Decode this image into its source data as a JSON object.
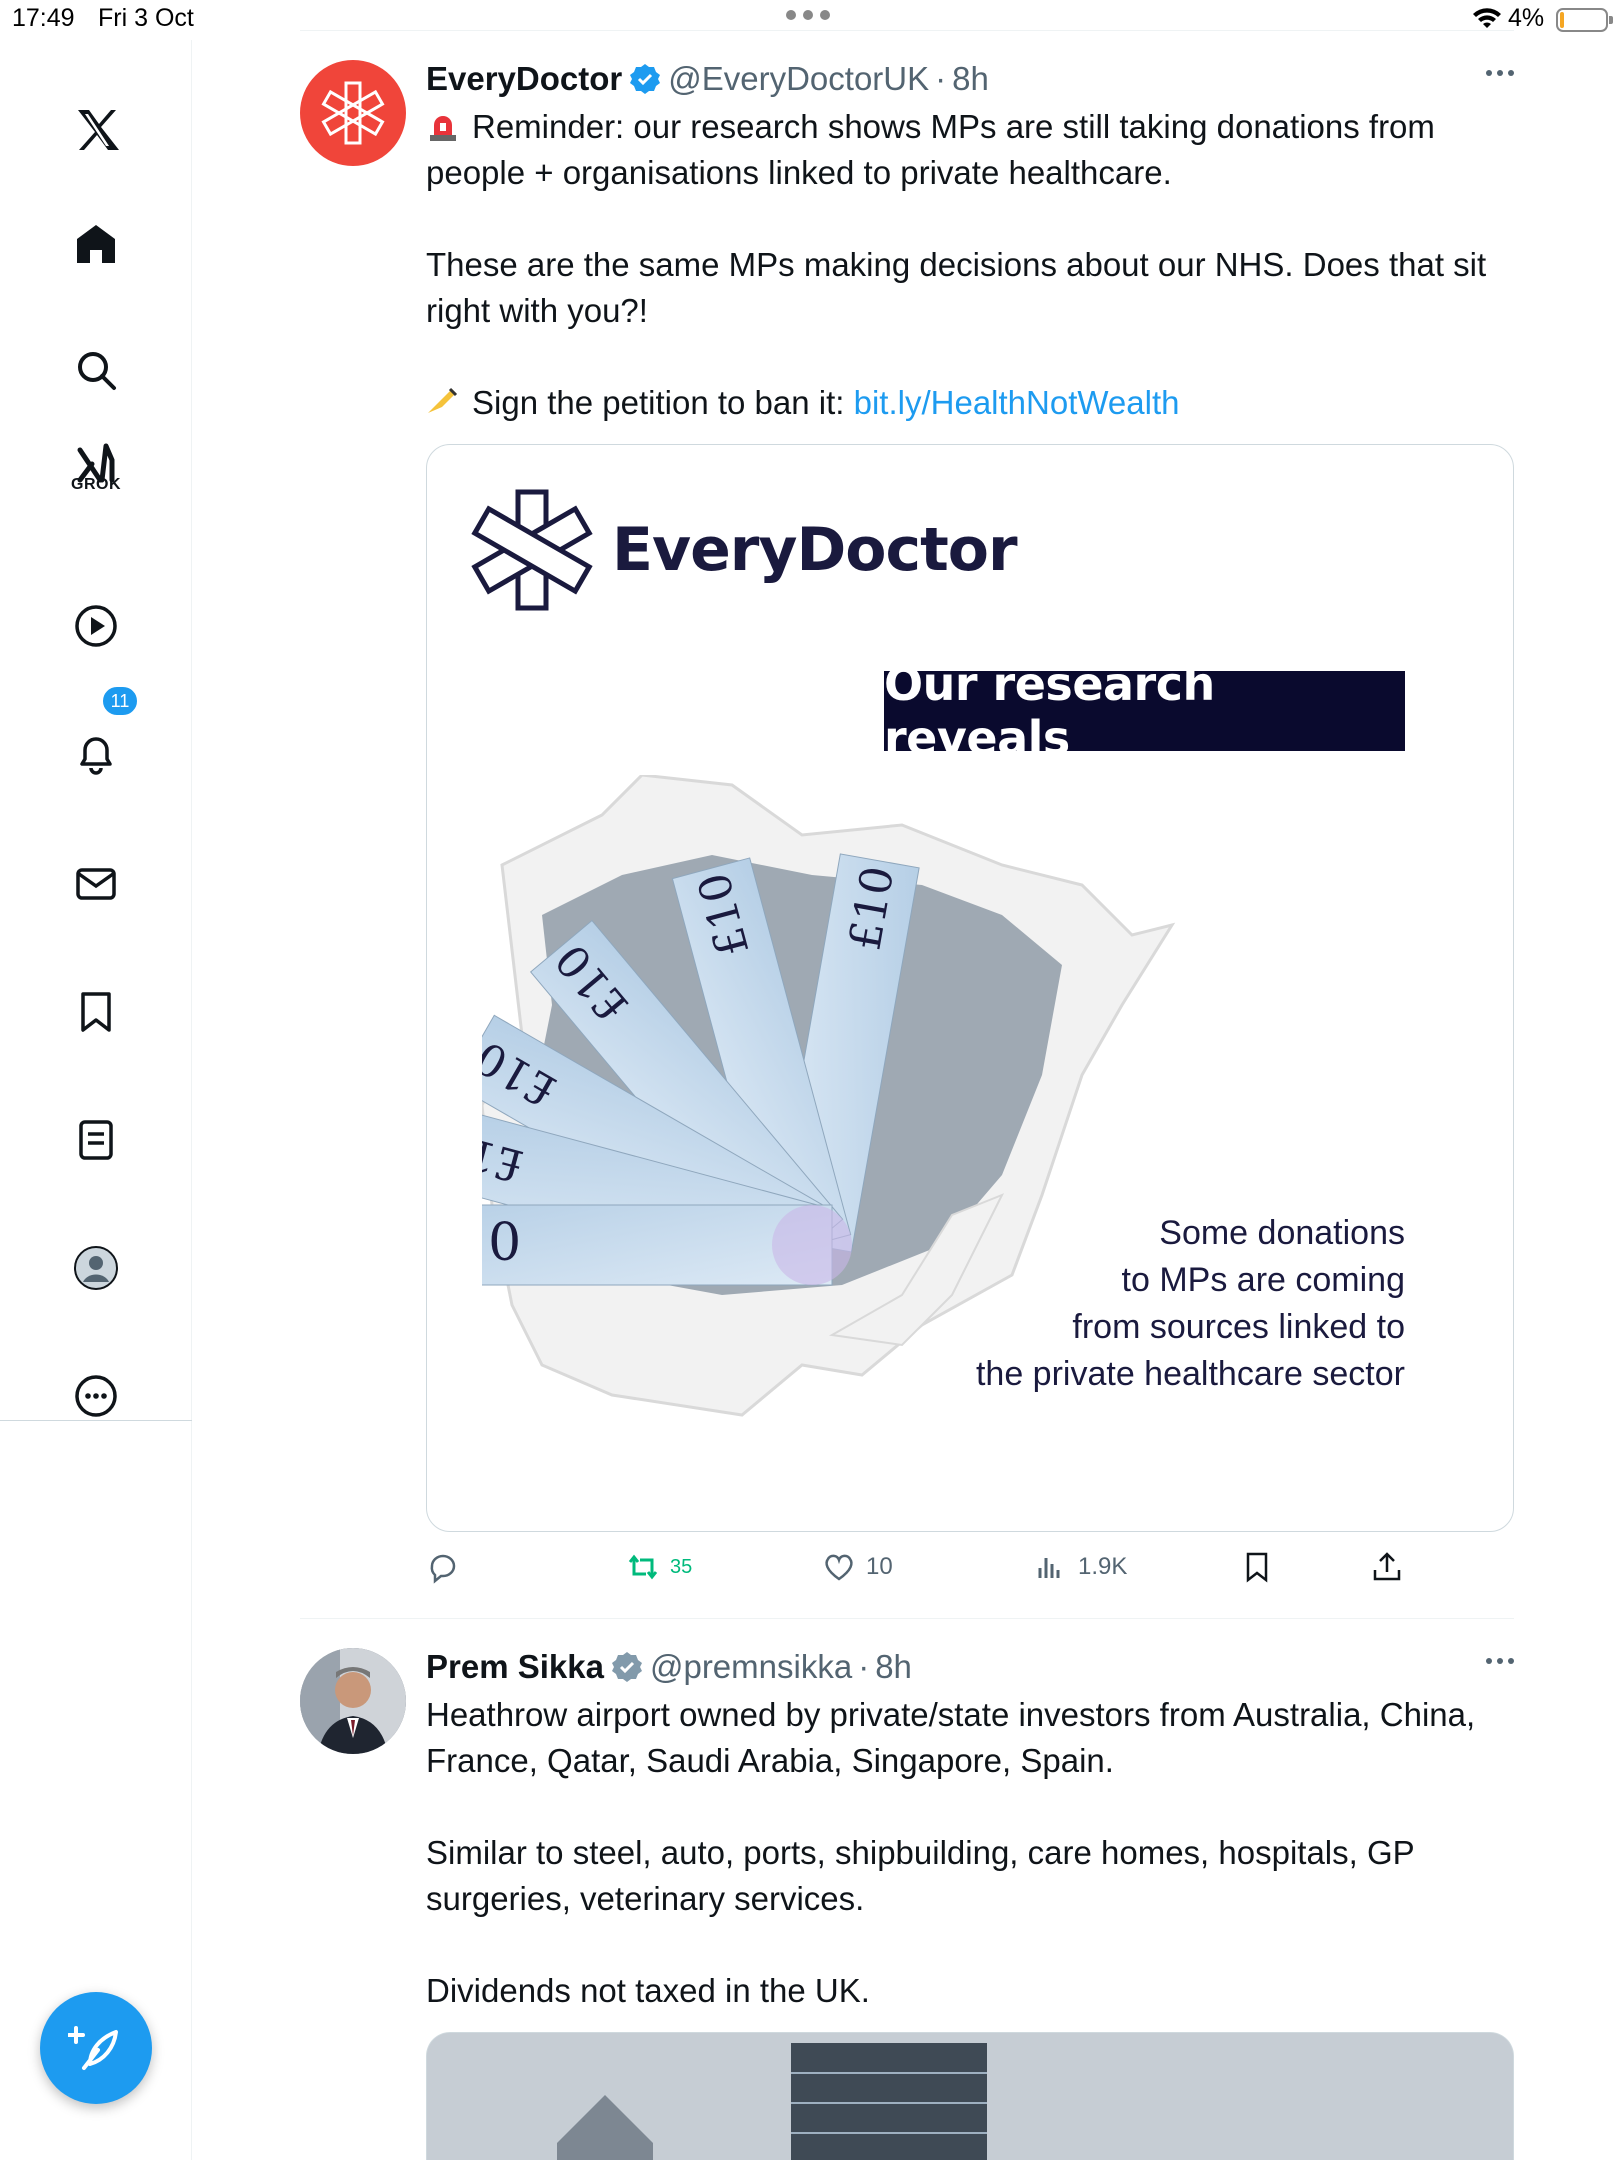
{
  "status_bar": {
    "time": "17:49",
    "date": "Fri 3 Oct",
    "battery": "4%",
    "battery_color": "#f5a623"
  },
  "sidebar": {
    "items": [
      {
        "name": "x-logo",
        "icon": "x-logo-icon"
      },
      {
        "name": "home",
        "icon": "home-icon"
      },
      {
        "name": "explore",
        "icon": "search-icon"
      },
      {
        "name": "grok",
        "icon": "grok-icon",
        "label": "GROK"
      },
      {
        "name": "video",
        "icon": "play-icon"
      },
      {
        "name": "notifications",
        "icon": "bell-icon",
        "badge": "11"
      },
      {
        "name": "messages",
        "icon": "mail-icon"
      },
      {
        "name": "bookmarks",
        "icon": "bookmark-icon"
      },
      {
        "name": "lists",
        "icon": "list-icon"
      },
      {
        "name": "profile",
        "icon": "profile-icon"
      },
      {
        "name": "more",
        "icon": "more-circle-icon"
      }
    ],
    "compose_icon": "compose-feather-icon",
    "accent": "#1d9bf0"
  },
  "tweets": [
    {
      "name": "EveryDoctor",
      "handle": "@EveryDoctorUK",
      "time": "8h",
      "text_lines": [
        "Reminder: our research shows MPs are still taking donations from people + organisations linked to private healthcare.",
        "These are the same MPs making decisions about our NHS. Does that sit right with you?!",
        "Sign the petition to ban it: "
      ],
      "link": "bit.ly/HealthNotWealth",
      "media": {
        "logo_text": "EveryDoctor",
        "banner": "Our research reveals",
        "caption_lines": [
          "Some donations",
          "to MPs are coming",
          "from sources linked to",
          "the private healthcare sector"
        ],
        "note_label": "£10"
      },
      "actions": {
        "replies": "",
        "retweets": "35",
        "likes": "10",
        "views": "1.9K"
      }
    },
    {
      "name": "Prem Sikka",
      "handle": "@premnsikka",
      "time": "8h",
      "text_lines": [
        "Heathrow airport owned by private/state investors from Australia, China, France, Qatar, Saudi Arabia, Singapore, Spain.",
        "Similar to steel, auto, ports, shipbuilding, care homes, hospitals, GP surgeries, veterinary services.",
        "Dividends not taxed in the UK."
      ]
    }
  ],
  "colors": {
    "text": "#0f1419",
    "secondary": "#536471",
    "retweet": "#00ba7c",
    "link": "#1d9bf0",
    "everydoctor_red": "#f0453a",
    "banner_bg": "#0a0a2e"
  }
}
